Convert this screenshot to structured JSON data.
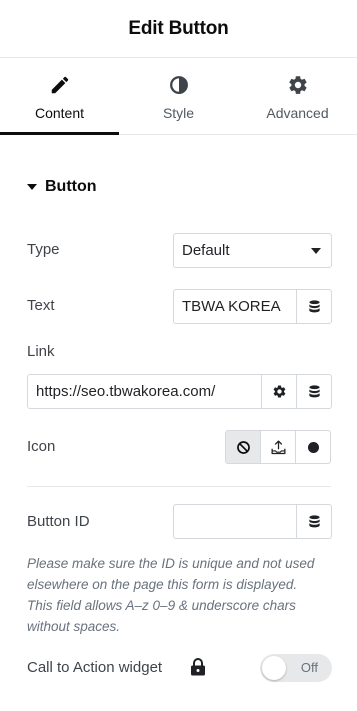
{
  "header": {
    "title": "Edit Button"
  },
  "tabs": [
    {
      "label": "Content",
      "icon": "pencil-icon",
      "active": true
    },
    {
      "label": "Style",
      "icon": "half-circle-icon",
      "active": false
    },
    {
      "label": "Advanced",
      "icon": "gear-icon",
      "active": false
    }
  ],
  "section": {
    "title": "Button",
    "expanded": true
  },
  "fields": {
    "type": {
      "label": "Type",
      "value": "Default"
    },
    "text": {
      "label": "Text",
      "value": "TBWA KOREA"
    },
    "link": {
      "label": "Link",
      "value": "https://seo.tbwakorea.com/"
    },
    "icon": {
      "label": "Icon",
      "options": [
        "none-icon",
        "upload-icon",
        "circle-icon"
      ],
      "selected": "none-icon"
    },
    "button_id": {
      "label": "Button ID",
      "value": ""
    }
  },
  "help_text": {
    "line1": "Please make sure the ID is unique and not used",
    "line2": "elsewhere on the page this form is displayed.",
    "line3": "This field allows A–z  0–9 & underscore chars",
    "line4": "without spaces."
  },
  "cta": {
    "label": "Call to Action widget",
    "toggle_text": "Off",
    "enabled": false
  },
  "colors": {
    "text_primary": "#0c0d0e",
    "text_secondary": "#3f444b",
    "muted": "#69727d",
    "border": "#d5d8dc",
    "bg_light": "#e6e8ea"
  }
}
